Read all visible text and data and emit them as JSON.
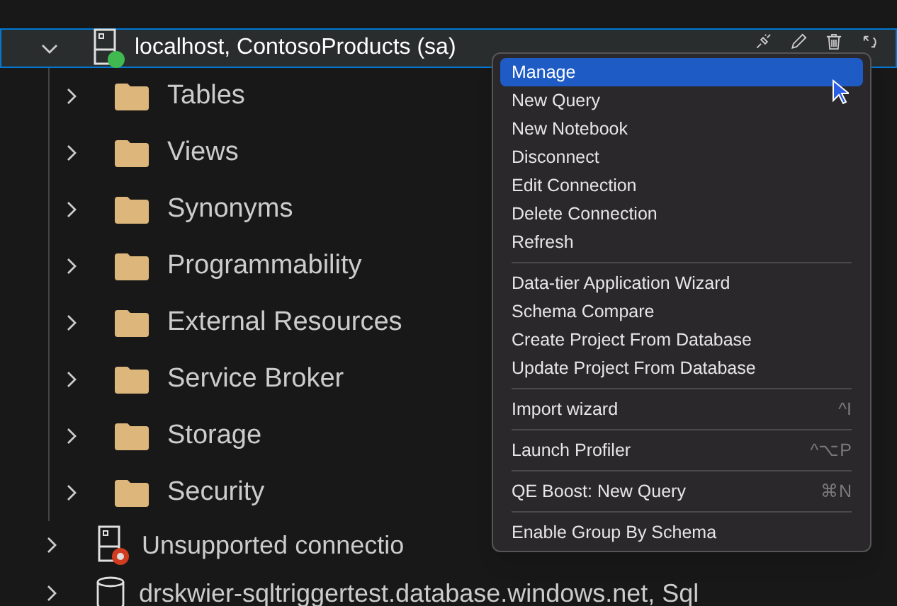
{
  "server": {
    "label": "localhost, ContosoProducts (sa)",
    "expanded": true,
    "color": "#3fb950",
    "selected": true
  },
  "folders": [
    {
      "label": "Tables",
      "expanded": false
    },
    {
      "label": "Views",
      "expanded": false
    },
    {
      "label": "Synonyms",
      "expanded": false
    },
    {
      "label": "Programmability",
      "expanded": false
    },
    {
      "label": "External Resources",
      "expanded": false
    },
    {
      "label": "Service Broker",
      "expanded": false
    },
    {
      "label": "Storage",
      "expanded": false
    },
    {
      "label": "Security",
      "expanded": false
    }
  ],
  "other_connections": [
    {
      "label": "Unsupported connectio",
      "kind": "server",
      "color": "#d13b1f",
      "expanded": false
    },
    {
      "label": "drskwier-sqltriggertest.database.windows.net, Sql",
      "kind": "database",
      "expanded": false
    }
  ],
  "context_menu": {
    "groups": [
      [
        {
          "label": "Manage",
          "selected": true
        },
        {
          "label": "New Query",
          "selected": false
        },
        {
          "label": "New Notebook",
          "selected": false
        },
        {
          "label": "Disconnect",
          "selected": false
        },
        {
          "label": "Edit Connection",
          "selected": false
        },
        {
          "label": "Delete Connection",
          "selected": false
        },
        {
          "label": "Refresh",
          "selected": false
        }
      ],
      [
        {
          "label": "Data-tier Application Wizard",
          "selected": false
        },
        {
          "label": "Schema Compare",
          "selected": false
        },
        {
          "label": "Create Project From Database",
          "selected": false
        },
        {
          "label": "Update Project From Database",
          "selected": false
        }
      ],
      [
        {
          "label": "Import wizard",
          "shortcut": "^I",
          "selected": false
        }
      ],
      [
        {
          "label": "Launch Profiler",
          "shortcut": "^⌥P",
          "selected": false
        }
      ],
      [
        {
          "label": "QE Boost: New Query",
          "shortcut": "⌘N",
          "selected": false
        }
      ],
      [
        {
          "label": "Enable Group By Schema",
          "selected": false
        }
      ]
    ]
  }
}
